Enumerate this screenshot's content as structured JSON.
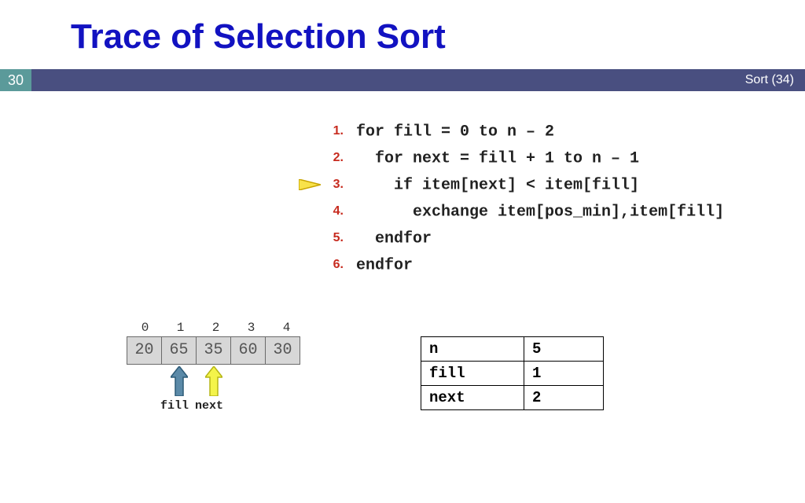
{
  "header": {
    "title": "Trace of Selection Sort",
    "slide_number": "30",
    "right_label": "Sort (34)"
  },
  "code": {
    "lines": [
      {
        "n": "1.",
        "text": "for fill = 0 to n – 2"
      },
      {
        "n": "2.",
        "text": "  for next = fill + 1 to n – 1"
      },
      {
        "n": "3.",
        "text": "    if item[next] < item[fill]"
      },
      {
        "n": "4.",
        "text": "      exchange item[pos_min],item[fill]"
      },
      {
        "n": "5.",
        "text": "  endfor"
      },
      {
        "n": "6.",
        "text": "endfor"
      }
    ],
    "current_line_index": 2
  },
  "array": {
    "indices": [
      "0",
      "1",
      "2",
      "3",
      "4"
    ],
    "values": [
      "20",
      "65",
      "35",
      "60",
      "30"
    ],
    "pointers": {
      "fill": {
        "label": "fill",
        "index": 1,
        "color": "#5b8aa8",
        "stroke": "#2d5b77"
      },
      "next": {
        "label": "next",
        "index": 2,
        "color": "#f4f44a",
        "stroke": "#b5b516"
      }
    }
  },
  "vars": {
    "rows": [
      {
        "k": "n",
        "v": "5"
      },
      {
        "k": "fill",
        "v": "1"
      },
      {
        "k": "next",
        "v": "2"
      }
    ]
  },
  "colors": {
    "title": "#1212c1",
    "bar": "#494f80",
    "slidenum_bg": "#5b9a9a",
    "lineno": "#c72b1f",
    "pointer_fill": "#f8e24a",
    "pointer_stroke": "#c8a400"
  }
}
